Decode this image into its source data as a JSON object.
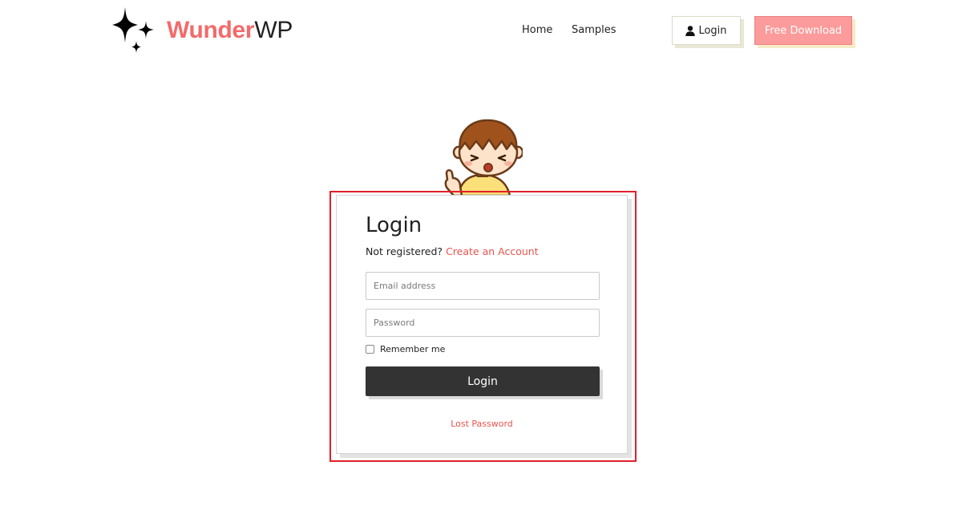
{
  "brand": {
    "name_part1": "Wunder",
    "name_part2": "WP",
    "accent_color": "#f26b6b",
    "icon": "sparkles-icon"
  },
  "nav": {
    "items": [
      {
        "label": "Home"
      },
      {
        "label": "Samples"
      }
    ]
  },
  "header_buttons": {
    "login_label": "Login",
    "login_icon": "user-icon",
    "free_download_label": "Free Download",
    "free_download_color": "#fb9b9b"
  },
  "login_form": {
    "title": "Login",
    "not_registered_text": "Not registered?",
    "create_account_link": "Create an Account",
    "email_placeholder": "Email address",
    "email_value": "",
    "password_placeholder": "Password",
    "password_value": "",
    "remember_label": "Remember me",
    "remember_checked": false,
    "submit_label": "Login",
    "lost_password_link": "Lost Password",
    "link_color": "#e8544e",
    "highlight_color": "#e0202a"
  },
  "mascot": {
    "icon": "boy-thumbs-up-mascot"
  }
}
